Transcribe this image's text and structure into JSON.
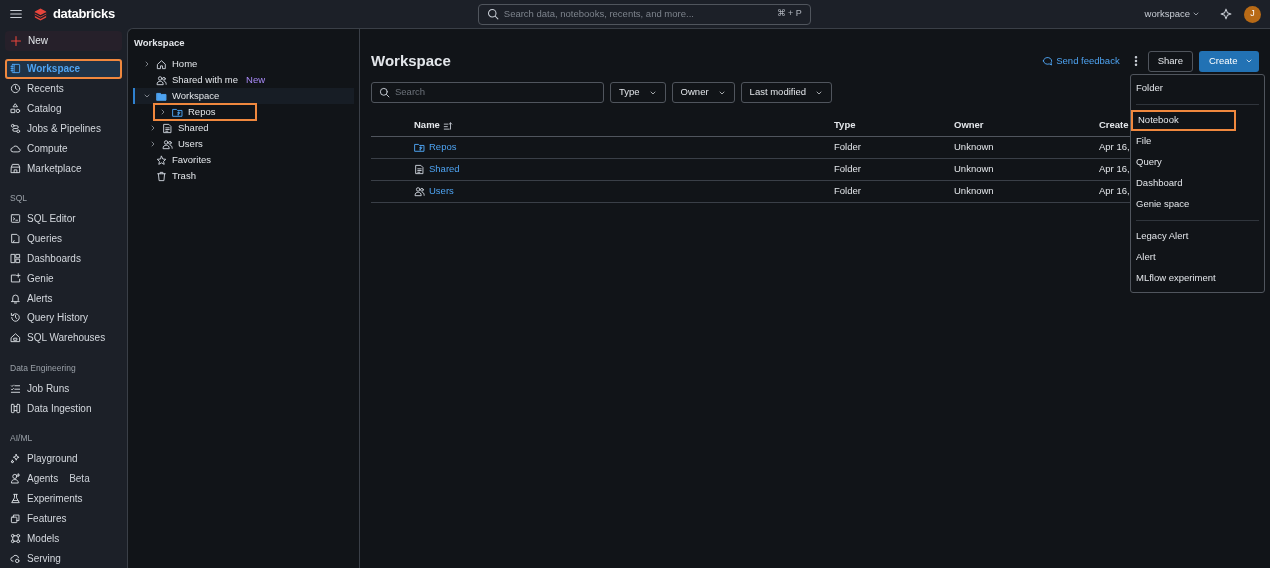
{
  "top_bar": {
    "logo": "databricks",
    "search": {
      "placeholder": "Search data, notebooks, recents, and more...",
      "shortcut": "⌘ + P"
    },
    "workspace_switcher": "workspace",
    "avatar": "J"
  },
  "sidebar": {
    "new_button": "New",
    "sections": [
      {
        "items": [
          {
            "label": "Workspace",
            "selected": true,
            "highlighted": true
          },
          {
            "label": "Recents",
            "selected": false,
            "highlighted": false
          },
          {
            "label": "Catalog",
            "selected": false,
            "highlighted": false
          },
          {
            "label": "Jobs & Pipelines",
            "selected": false,
            "highlighted": false
          },
          {
            "label": "Compute",
            "selected": false,
            "highlighted": false
          },
          {
            "label": "Marketplace",
            "selected": false,
            "highlighted": false
          }
        ]
      },
      {
        "title": "SQL",
        "items": [
          {
            "label": "SQL Editor",
            "selected": false,
            "highlighted": false
          },
          {
            "label": "Queries",
            "selected": false,
            "highlighted": false
          },
          {
            "label": "Dashboards",
            "selected": false,
            "highlighted": false
          },
          {
            "label": "Genie",
            "selected": false,
            "highlighted": false
          },
          {
            "label": "Alerts",
            "selected": false,
            "highlighted": false
          },
          {
            "label": "Query History",
            "selected": false,
            "highlighted": false
          },
          {
            "label": "SQL Warehouses",
            "selected": false,
            "highlighted": false
          }
        ]
      },
      {
        "title": "Data Engineering",
        "items": [
          {
            "label": "Job Runs",
            "selected": false,
            "highlighted": false
          },
          {
            "label": "Data Ingestion",
            "selected": false,
            "highlighted": false
          }
        ]
      },
      {
        "title": "AI/ML",
        "items": [
          {
            "label": "Playground",
            "selected": false,
            "highlighted": false
          },
          {
            "label": "Agents",
            "badge": "Beta",
            "selected": false,
            "highlighted": false
          },
          {
            "label": "Experiments",
            "selected": false,
            "highlighted": false
          },
          {
            "label": "Features",
            "selected": false,
            "highlighted": false
          },
          {
            "label": "Models",
            "selected": false,
            "highlighted": false
          },
          {
            "label": "Serving",
            "selected": false,
            "highlighted": false
          }
        ]
      }
    ]
  },
  "tree": {
    "title": "Workspace",
    "items": [
      {
        "label": "Home",
        "expanded": false,
        "selected": false,
        "highlighted": false
      },
      {
        "label": "Shared with me",
        "badge": "New",
        "selected": false,
        "highlighted": false
      },
      {
        "label": "Workspace",
        "expanded": true,
        "selected": true,
        "highlighted": false,
        "children": [
          {
            "label": "Repos",
            "expanded": false,
            "selected": false,
            "highlighted": true
          },
          {
            "label": "Shared",
            "expanded": false,
            "selected": false,
            "highlighted": false
          },
          {
            "label": "Users",
            "expanded": false,
            "selected": false,
            "highlighted": false
          }
        ]
      },
      {
        "label": "Favorites",
        "selected": false,
        "highlighted": false
      },
      {
        "label": "Trash",
        "selected": false,
        "highlighted": false
      }
    ]
  },
  "main": {
    "title": "Workspace",
    "send_feedback": "Send feedback",
    "share_button": "Share",
    "create_button": "Create",
    "search": {
      "placeholder": "Search"
    },
    "filters": [
      "Type",
      "Owner",
      "Last modified"
    ],
    "table": {
      "columns": [
        "Name",
        "Type",
        "Owner",
        "Create"
      ],
      "rows": [
        [
          "Repos",
          "Folder",
          "Unknown",
          "Apr 16,"
        ],
        [
          "Shared",
          "Folder",
          "Unknown",
          "Apr 16,"
        ],
        [
          "Users",
          "Folder",
          "Unknown",
          "Apr 16,"
        ]
      ]
    }
  },
  "create_menu": {
    "groups": [
      [
        {
          "label": "Folder",
          "highlighted": false
        }
      ],
      [
        {
          "label": "Notebook",
          "highlighted": true
        },
        {
          "label": "File",
          "highlighted": false
        },
        {
          "label": "Query",
          "highlighted": false
        },
        {
          "label": "Dashboard",
          "highlighted": false
        },
        {
          "label": "Genie space",
          "highlighted": false
        }
      ],
      [
        {
          "label": "Legacy Alert",
          "highlighted": false
        },
        {
          "label": "Alert",
          "highlighted": false
        },
        {
          "label": "MLflow experiment",
          "highlighted": false
        }
      ]
    ]
  }
}
